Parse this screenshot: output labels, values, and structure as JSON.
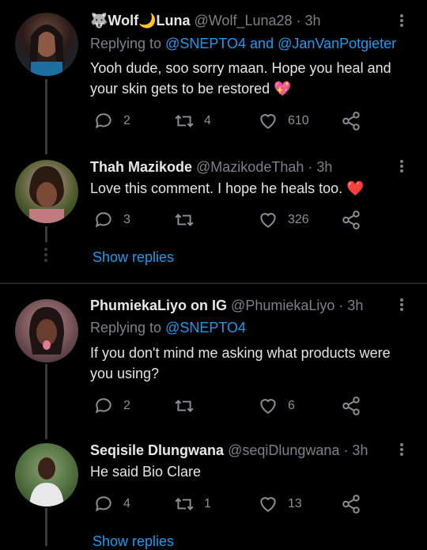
{
  "tweets": [
    {
      "name": "🐺Wolf🌙Luna",
      "handle": "@Wolf_Luna28",
      "time": "· 3h",
      "replying_prefix": "Replying to ",
      "replying_to_1": "@SNEPTO4",
      "replying_and": " and ",
      "replying_to_2": "@JanVanPotgieter",
      "text": "Yooh dude, soo sorry maan. Hope you heal and your skin gets to be restored 💖",
      "replies": "2",
      "retweets": "4",
      "likes": "610"
    },
    {
      "name": "Thah Mazikode",
      "handle": "@MazikodeThah",
      "time": "· 3h",
      "text": "Love this comment. I hope he heals too. ❤️",
      "replies": "3",
      "retweets": "",
      "likes": "326"
    },
    {
      "name": "PhumiekaLiyo on IG",
      "handle": "@PhumiekaLiyo",
      "time": "· 3h",
      "replying_prefix": "Replying to ",
      "replying_to_1": "@SNEPTO4",
      "text": "If you don't mind me asking what products were you using?",
      "replies": "2",
      "retweets": "",
      "likes": "6"
    },
    {
      "name": "Seqisile Dlungwana",
      "handle": "@seqiDlungwana",
      "time": "· 3h",
      "text": "He said Bio Clare",
      "replies": "4",
      "retweets": "1",
      "likes": "13"
    }
  ],
  "show_replies_label": "Show replies",
  "colors": {
    "accent": "#1d9bf0",
    "background": "#000000",
    "muted": "#7b8287"
  }
}
